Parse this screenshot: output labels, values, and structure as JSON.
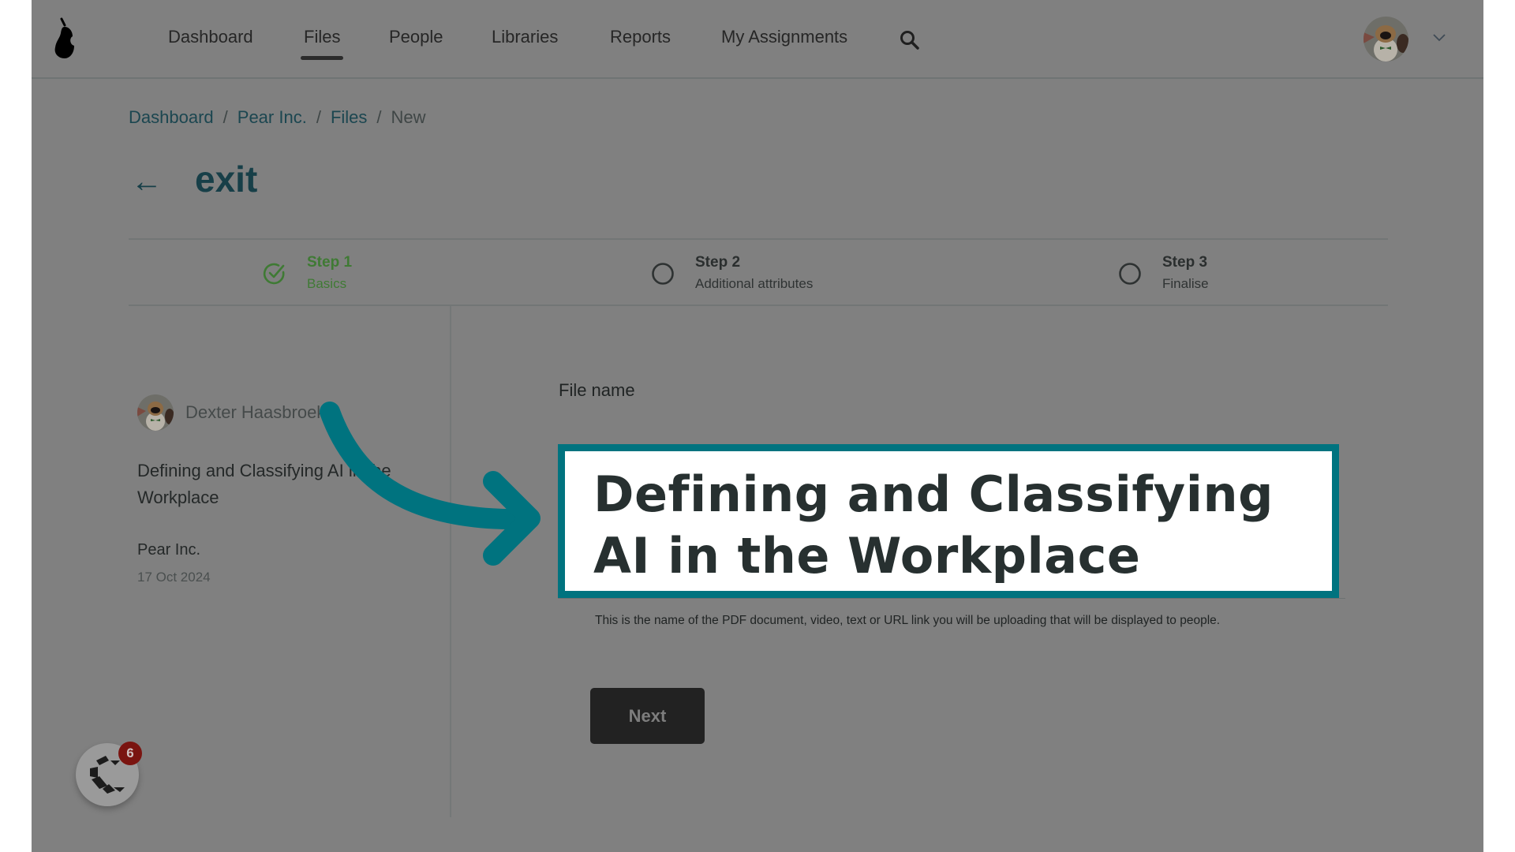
{
  "nav": {
    "items": [
      {
        "label": "Dashboard",
        "active": false
      },
      {
        "label": "Files",
        "active": true
      },
      {
        "label": "People",
        "active": false
      },
      {
        "label": "Libraries",
        "active": false
      },
      {
        "label": "Reports",
        "active": false
      },
      {
        "label": "My Assignments",
        "active": false
      }
    ],
    "search_icon": "search-icon",
    "account_menu_icon": "chevron-down-icon"
  },
  "breadcrumb": [
    {
      "label": "Dashboard"
    },
    {
      "label": "Pear Inc."
    },
    {
      "label": "Files"
    },
    {
      "label": "New"
    }
  ],
  "breadcrumb_separator": "/",
  "header": {
    "back_icon": "←",
    "title": "exit"
  },
  "stepper": [
    {
      "title": "Step 1",
      "subtitle": "Basics",
      "status": "complete"
    },
    {
      "title": "Step 2",
      "subtitle": "Additional attributes",
      "status": "pending"
    },
    {
      "title": "Step 3",
      "subtitle": "Finalise",
      "status": "pending"
    }
  ],
  "preview": {
    "author": "Dexter Haasbroek",
    "title": "Defining and Classifying AI in the Workplace",
    "organization": "Pear Inc.",
    "date": "17 Oct 2024"
  },
  "form": {
    "file_name_label": "File name",
    "file_name_value": "Defining and Classifying AI in the Workplace",
    "helper_text": "This is the name of the PDF document, video, text or URL link you will be uploading that will be displayed to people.",
    "next_label": "Next"
  },
  "chat_widget": {
    "badge_count": "6"
  },
  "colors": {
    "accent_teal": "#00737f",
    "step_complete": "#3f7a34",
    "badge": "#7a1410",
    "overlay": "#808080"
  }
}
